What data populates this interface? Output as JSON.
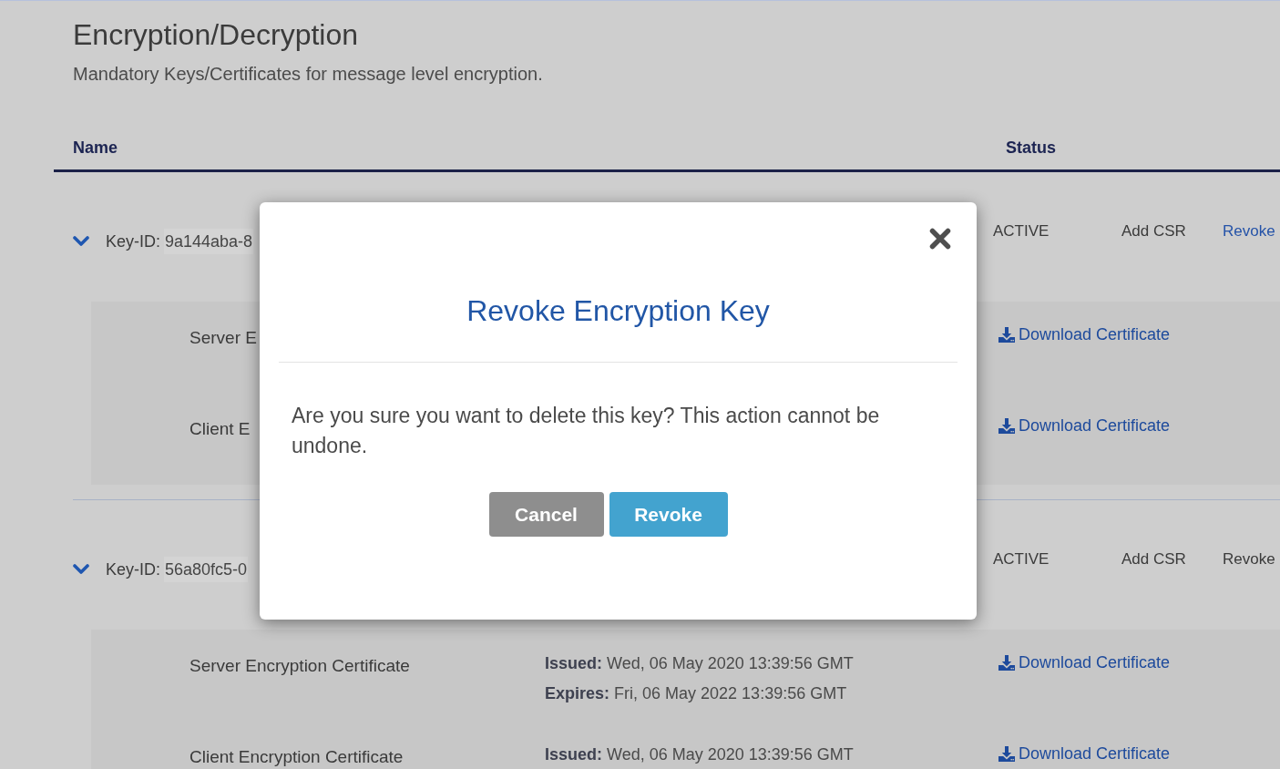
{
  "page": {
    "title": "Encryption/Decryption",
    "subtitle": "Mandatory Keys/Certificates for message level encryption."
  },
  "table": {
    "columns": [
      "Name",
      "Status"
    ],
    "keys": [
      {
        "label": "Key-ID:",
        "id": "9a144aba-8",
        "expanded": true,
        "status": "ACTIVE",
        "add_csr": "Add CSR",
        "revoke": "Revoke",
        "revoke_highlighted": true,
        "certificates": [
          {
            "name": "Server E",
            "download": "Download Certificate"
          },
          {
            "name": "Client E",
            "download": "Download Certificate"
          }
        ]
      },
      {
        "label": "Key-ID:",
        "id": "56a80fc5-0",
        "expanded": true,
        "status": "ACTIVE",
        "add_csr": "Add CSR",
        "revoke": "Revoke",
        "revoke_highlighted": false,
        "certificates": [
          {
            "name": "Server Encryption Certificate",
            "dates": [
              "**Issued:** Wed, 06 May 2020 13:39:56 GMT",
              "**Expires:** Fri, 06 May 2022 13:39:56 GMT"
            ],
            "download": "Download Certificate"
          },
          {
            "name": "Client Encryption Certificate",
            "dates": [
              "**Issued:** Wed, 06 May 2020 13:39:56 GMT"
            ],
            "download": "Download Certificate"
          }
        ]
      }
    ]
  },
  "dialog": {
    "title": "Revoke Encryption Key",
    "message": "Are you sure you want to delete this key? This action cannot be undone.",
    "buttons": [
      {
        "label": "Cancel",
        "kind": "secondary"
      },
      {
        "label": "Revoke",
        "kind": "primary"
      }
    ]
  }
}
